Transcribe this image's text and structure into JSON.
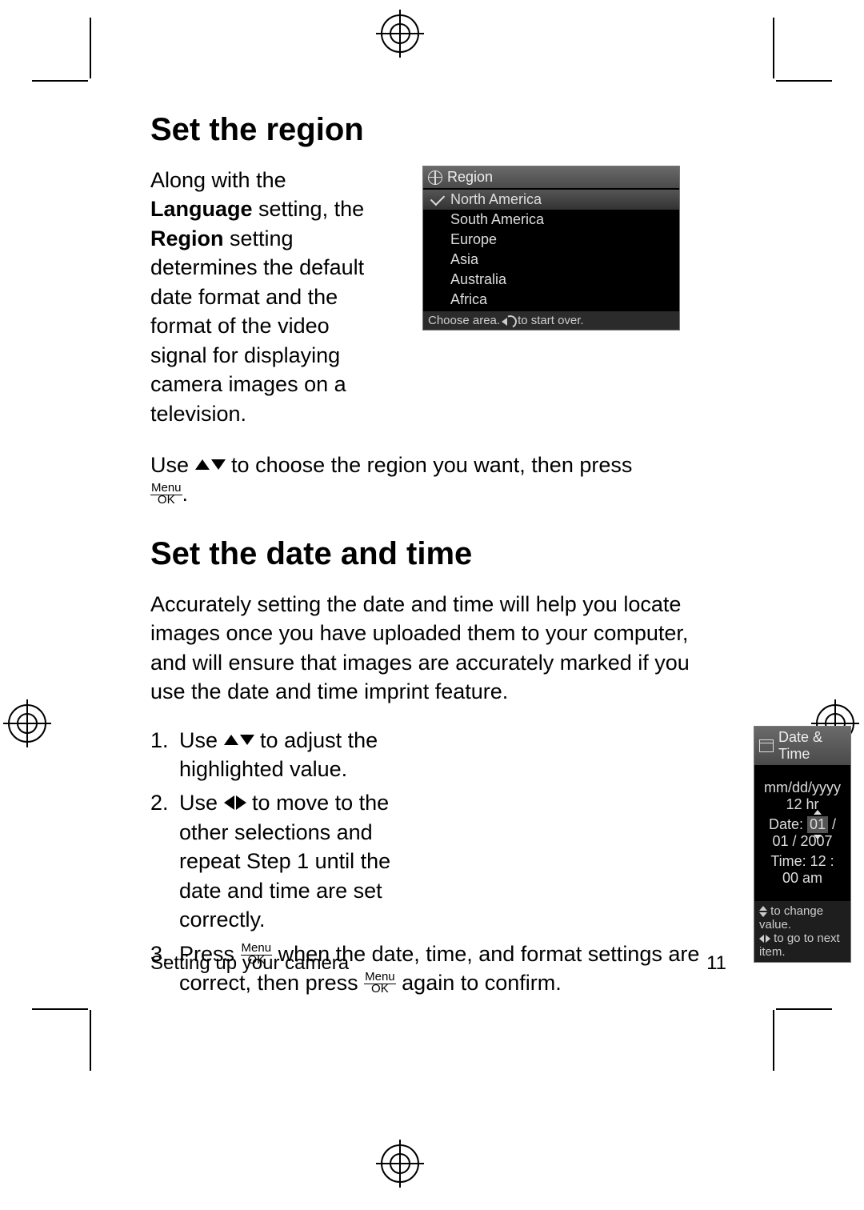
{
  "headings": {
    "region": "Set the region",
    "datetime": "Set the date and time"
  },
  "para": {
    "region_a": "Along with the ",
    "region_b": "Language",
    "region_c": " setting, the ",
    "region_d": "Region",
    "region_e": " setting determines the default date format and the format of the video signal for displaying camera images on a television.",
    "use_region_a": "Use ",
    "use_region_b": " to choose the region you want, then press ",
    "use_region_c": ".",
    "datetime_intro": "Accurately setting the date and time will help you locate images once you have uploaded them to your computer, and will ensure that images are accurately marked if you use the date and time imprint feature."
  },
  "menu_ok": {
    "top": "Menu",
    "bottom": "OK"
  },
  "region_screen": {
    "title": "Region",
    "options": [
      "North America",
      "South America",
      "Europe",
      "Asia",
      "Australia",
      "Africa"
    ],
    "status_a": "Choose area. ",
    "status_b": " to start over."
  },
  "steps": {
    "s1a": "Use ",
    "s1b": " to adjust the highlighted value.",
    "s2a": "Use ",
    "s2b": " to move to the other selections and repeat Step 1 until the date and time are set correctly.",
    "s3a": "Press ",
    "s3b": " when the date, time, and format settings are correct, then press ",
    "s3c": " again to confirm."
  },
  "dt_screen": {
    "title": "Date & Time",
    "format": "mm/dd/yyyy  12 hr",
    "date_label": "Date:  ",
    "date_hl": "01",
    "date_rest": " / 01 / 2007",
    "time_label": "Time:  12 : 00  am",
    "status_a": " to change value.",
    "status_b": " to go to next item."
  },
  "footer": {
    "left": "Setting up your camera",
    "right": "11"
  }
}
